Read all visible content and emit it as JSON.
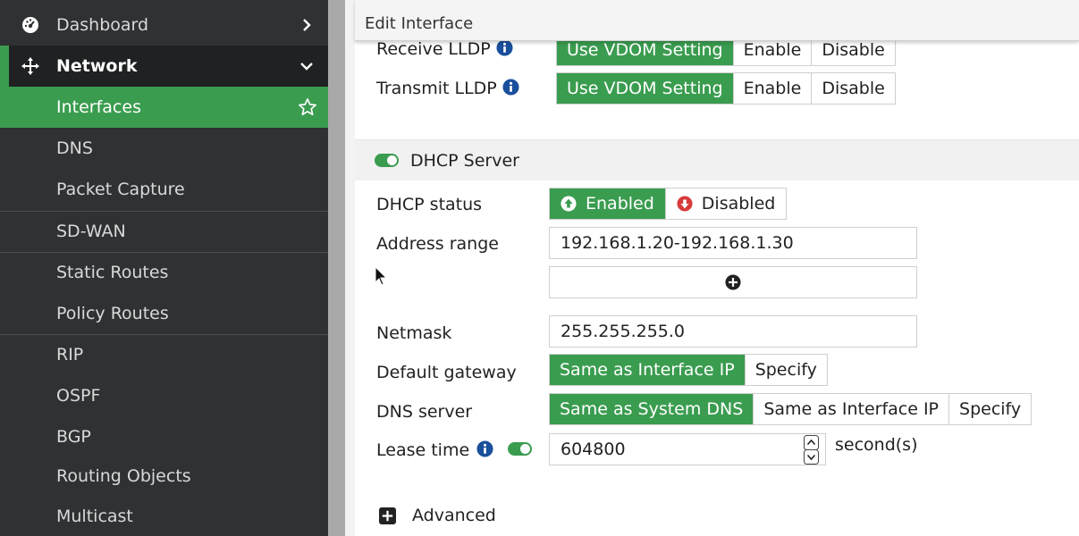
{
  "sidebar": {
    "top_items": [
      {
        "label": "Dashboard",
        "icon": "dashboard-icon"
      },
      {
        "label": "Network",
        "icon": "network-icon"
      }
    ],
    "items": [
      {
        "label": "Interfaces"
      },
      {
        "label": "DNS"
      },
      {
        "label": "Packet Capture"
      },
      {
        "label": "SD-WAN"
      },
      {
        "label": "Static Routes"
      },
      {
        "label": "Policy Routes"
      },
      {
        "label": "RIP"
      },
      {
        "label": "OSPF"
      },
      {
        "label": "BGP"
      },
      {
        "label": "Routing Objects"
      },
      {
        "label": "Multicast"
      }
    ],
    "active_item": "Interfaces"
  },
  "header": {
    "title": "Edit Interface"
  },
  "lldp": {
    "receive_label": "Receive LLDP",
    "transmit_label": "Transmit LLDP",
    "options": [
      "Use VDOM Setting",
      "Enable",
      "Disable"
    ],
    "receive_selected": "Use VDOM Setting",
    "transmit_selected": "Use VDOM Setting"
  },
  "dhcp": {
    "section_label": "DHCP Server",
    "status_label": "DHCP status",
    "status_enabled": "Enabled",
    "status_disabled": "Disabled",
    "address_range_label": "Address range",
    "address_range_value": "192.168.1.20-192.168.1.30",
    "netmask_label": "Netmask",
    "netmask_value": "255.255.255.0",
    "gateway_label": "Default gateway",
    "gateway_options": [
      "Same as Interface IP",
      "Specify"
    ],
    "dns_label": "DNS server",
    "dns_options": [
      "Same as System DNS",
      "Same as Interface IP",
      "Specify"
    ],
    "lease_label": "Lease time",
    "lease_value": "604800",
    "lease_unit": "second(s)",
    "advanced_label": "Advanced"
  },
  "colors": {
    "accent": "#3a9c4f",
    "sidebar_bg": "#2f3133",
    "disabled_red": "#d83b3b"
  }
}
